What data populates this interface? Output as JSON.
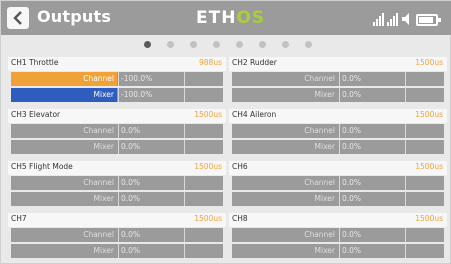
{
  "header": {
    "title": "Outputs",
    "logo_main": "ETH",
    "logo_accent": "OS",
    "icons": [
      "signal-bars-icon",
      "speaker-icon",
      "battery-icon"
    ]
  },
  "pagination": {
    "count": 8,
    "active_index": 0
  },
  "colors": {
    "accent_orange": "#f0a239",
    "mixer_blue": "#2e5dbd",
    "header_gray": "#9b9b9b",
    "logo_green": "#a8cf3a"
  },
  "channels": [
    {
      "name": "CH1  Throttle",
      "value": "988us",
      "channel_label": "Channel",
      "channel_value": "-100.0%",
      "mixer_label": "Mixer",
      "mixer_value": "-100.0%"
    },
    {
      "name": "CH2  Rudder",
      "value": "1500us",
      "channel_label": "Channel",
      "channel_value": "0.0%",
      "mixer_label": "Mixer",
      "mixer_value": "0.0%"
    },
    {
      "name": "CH3  Elevator",
      "value": "1500us",
      "channel_label": "Channel",
      "channel_value": "0.0%",
      "mixer_label": "Mixer",
      "mixer_value": "0.0%"
    },
    {
      "name": "CH4  Aileron",
      "value": "1500us",
      "channel_label": "Channel",
      "channel_value": "0.0%",
      "mixer_label": "Mixer",
      "mixer_value": "0.0%"
    },
    {
      "name": "CH5  Flight Mode",
      "value": "1500us",
      "channel_label": "Channel",
      "channel_value": "0.0%",
      "mixer_label": "Mixer",
      "mixer_value": "0.0%"
    },
    {
      "name": "CH6",
      "value": "1500us",
      "channel_label": "Channel",
      "channel_value": "0.0%",
      "mixer_label": "Mixer",
      "mixer_value": "0.0%"
    },
    {
      "name": "CH7",
      "value": "1500us",
      "channel_label": "Channel",
      "channel_value": "0.0%",
      "mixer_label": "Mixer",
      "mixer_value": "0.0%"
    },
    {
      "name": "CH8",
      "value": "1500us",
      "channel_label": "Channel",
      "channel_value": "0.0%",
      "mixer_label": "Mixer",
      "mixer_value": "0.0%"
    }
  ]
}
